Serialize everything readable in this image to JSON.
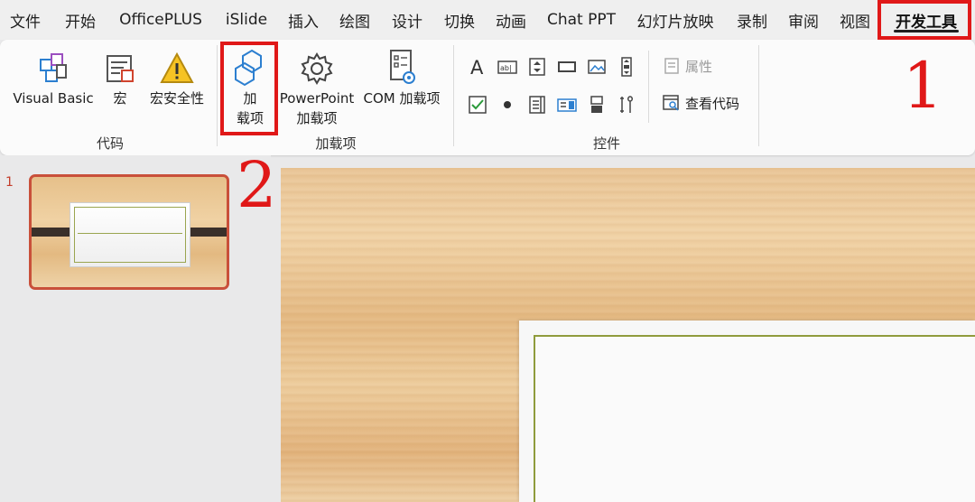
{
  "menu": {
    "tabs": [
      "文件",
      "开始",
      "OfficePLUS",
      "iSlide",
      "插入",
      "绘图",
      "设计",
      "切换",
      "动画",
      "Chat PPT",
      "幻灯片放映",
      "录制",
      "审阅",
      "视图",
      "开发工具"
    ],
    "active_tab": "开发工具"
  },
  "ribbon": {
    "code_group": {
      "label": "代码",
      "visual_basic": "Visual Basic",
      "macro": "宏",
      "macro_security": "宏安全性"
    },
    "addins_group": {
      "label": "加载项",
      "addins": "加\n载项",
      "powerpoint_addins": "PowerPoint\n加载项",
      "com_addins": "COM 加载项"
    },
    "controls_group": {
      "label": "控件",
      "properties": "属性",
      "view_code": "查看代码"
    }
  },
  "annotations": {
    "step1": "1",
    "step2": "2",
    "color": "#e01818"
  },
  "slides": {
    "current_number": "1"
  }
}
